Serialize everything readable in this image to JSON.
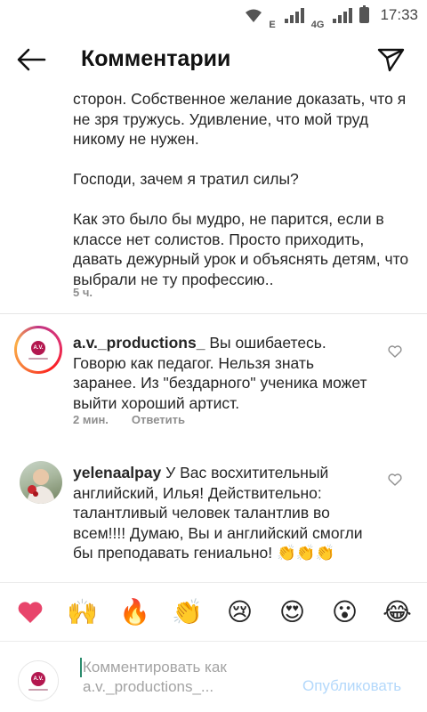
{
  "status_bar": {
    "net_e": "E",
    "net_4g": "4G",
    "time": "17:33"
  },
  "header": {
    "title": "Комментарии"
  },
  "post": {
    "paragraphs": [
      "сторон. Собственное желание доказать, что я не зря тружусь. Удивление, что мой труд никому не нужен.",
      "Господи, зачем я тратил силы?",
      "Как это было бы мудро, не парится, если в классе нет солистов. Просто приходить, давать дежурный урок и объяснять детям, что выбрали не ту профессию.."
    ],
    "time": "5 ч."
  },
  "comments": [
    {
      "username": "a.v._productions_",
      "text": " Вы ошибаетесь. Говорю как педагог. Нельзя знать заранее. Из \"бездарного\" ученика может выйти хороший артист.",
      "time": "2 мин.",
      "reply": "Ответить",
      "avatar_text": "A.V."
    },
    {
      "username": "yelenaalpay",
      "text": " У Вас восхитительный английский, Илья! Действительно: талантливый человек талантлив во всем!!!! Думаю, Вы и английский смогли бы преподавать гениально! 👏👏👏"
    }
  ],
  "emoji_bar": [
    "❤️",
    "🙌",
    "🔥",
    "👏",
    "😢",
    "😍",
    "😮",
    "😂"
  ],
  "composer": {
    "placeholder": "Комментировать как a.v._productions_...",
    "placeholder_line1": "Комментировать как",
    "placeholder_line2": "a.v._productions_...",
    "publish": "Опубликовать",
    "avatar_text": "A.V."
  },
  "colors": {
    "username": "#262626",
    "meta": "#8e8e8e",
    "publish_disabled": "#b3d8fb",
    "heart": "#e8456b"
  }
}
